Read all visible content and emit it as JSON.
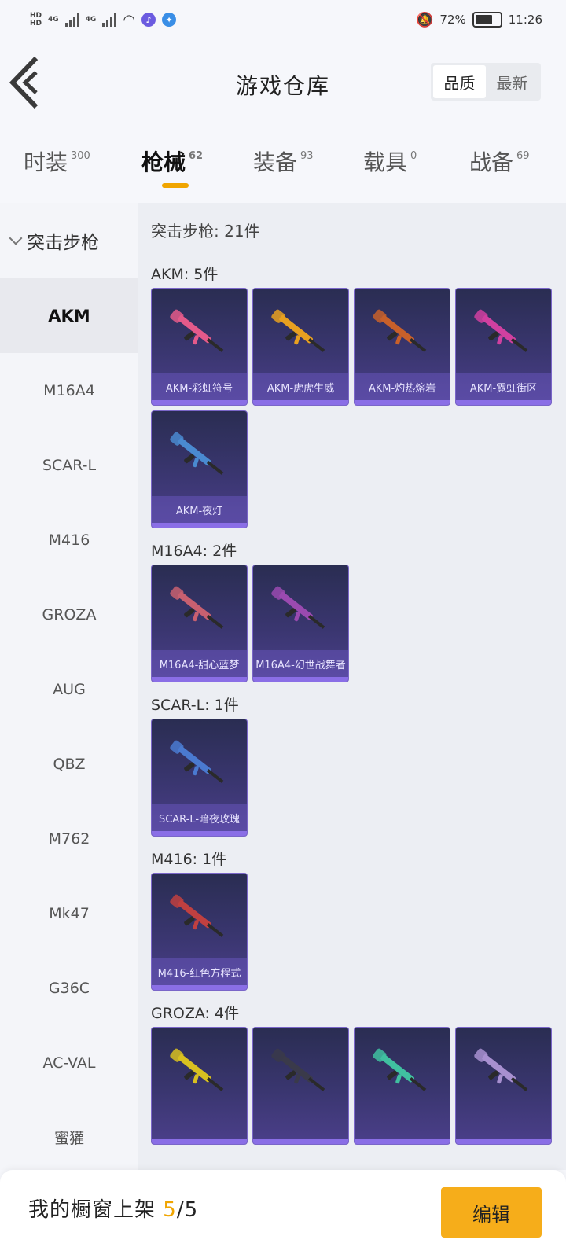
{
  "status": {
    "signal_a": "4G",
    "signal_b": "4G",
    "battery": "72%",
    "time": "11:26"
  },
  "header": {
    "title": "游戏仓库",
    "sort_quality": "品质",
    "sort_latest": "最新"
  },
  "tabs": [
    {
      "label": "时装",
      "count": "300"
    },
    {
      "label": "枪械",
      "count": "62"
    },
    {
      "label": "装备",
      "count": "93"
    },
    {
      "label": "载具",
      "count": "0"
    },
    {
      "label": "战备",
      "count": "69"
    }
  ],
  "sidebar": {
    "category": "突击步枪",
    "items": [
      "AKM",
      "M16A4",
      "SCAR-L",
      "M416",
      "GROZA",
      "AUG",
      "QBZ",
      "M762",
      "Mk47",
      "G36C",
      "AC-VAL",
      "蜜獾"
    ]
  },
  "content": {
    "summary": "突击步枪: 21件",
    "groups": [
      {
        "title": "AKM: 5件",
        "items": [
          "AKM-彩虹符号",
          "AKM-虎虎生威",
          "AKM-灼热熔岩",
          "AKM-霓虹街区",
          "AKM-夜灯"
        ]
      },
      {
        "title": "M16A4: 2件",
        "items": [
          "M16A4-甜心蓝梦",
          "M16A4-幻世战舞者"
        ]
      },
      {
        "title": "SCAR-L: 1件",
        "items": [
          "SCAR-L-暗夜玫瑰"
        ]
      },
      {
        "title": "M416: 1件",
        "items": [
          "M416-红色方程式"
        ]
      },
      {
        "title": "GROZA: 4件",
        "items": [
          "",
          "",
          "",
          ""
        ]
      }
    ]
  },
  "bottom": {
    "showcase_label": "我的橱窗上架",
    "current": "5",
    "total": "/5",
    "edit": "编辑"
  }
}
